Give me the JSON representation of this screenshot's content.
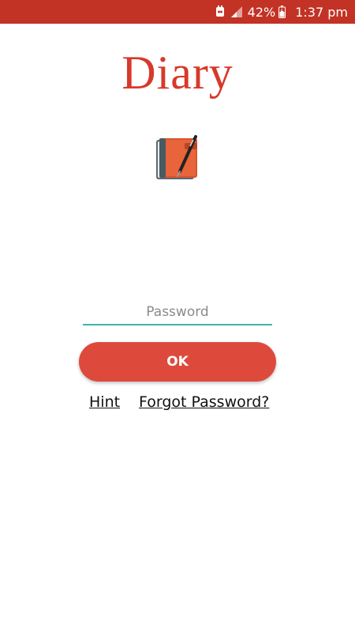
{
  "status_bar": {
    "battery_percent": "42%",
    "time": "1:37 pm",
    "icons": [
      "notification-icon",
      "signal-icon",
      "battery-icon"
    ]
  },
  "app": {
    "title": "Diary",
    "logo_icon": "diary-notebook-icon"
  },
  "login": {
    "password_placeholder": "Password",
    "password_value": "",
    "ok_label": "OK",
    "hint_label": "Hint",
    "forgot_label": "Forgot Password?"
  },
  "colors": {
    "status_bar": "#c23325",
    "title": "#d63a2a",
    "button": "#dd4a3c",
    "field_underline": "#3fb5a6"
  }
}
